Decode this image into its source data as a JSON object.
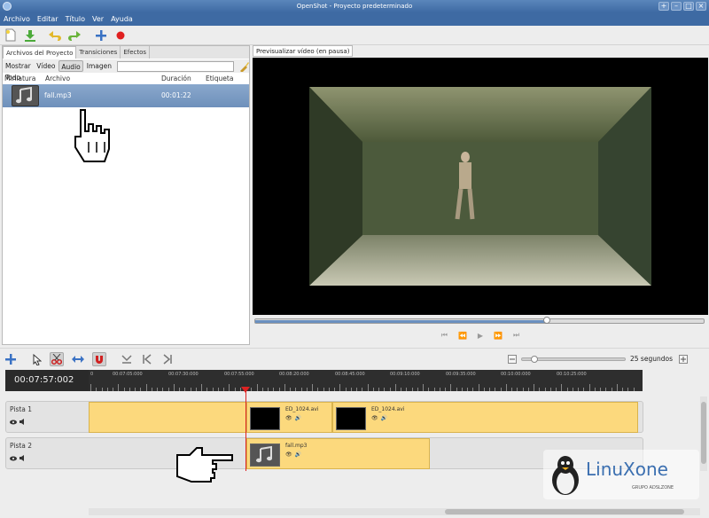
{
  "window": {
    "title": "OpenShot - Proyecto predeterminado"
  },
  "menu": {
    "items": [
      "Archivo",
      "Editar",
      "Título",
      "Ver",
      "Ayuda"
    ]
  },
  "project": {
    "tabs": [
      "Archivos del Proyecto",
      "Transiciones",
      "Efectos"
    ],
    "filters": [
      "Mostrar Todo",
      "Vídeo",
      "Audio",
      "Imagen"
    ],
    "active_filter": "Audio",
    "search_placeholder": "",
    "columns": [
      "Miniatura",
      "Archivo",
      "Duración",
      "Etiqueta"
    ],
    "files": [
      {
        "name": "fall.mp3",
        "duration": "00:01:22",
        "label": ""
      }
    ]
  },
  "preview": {
    "label": "Previsualizar vídeo (en pausa)",
    "position": 0.65
  },
  "timeline": {
    "timecode": "00:07:57:002",
    "zoom_label": "25 segundos",
    "ruler_labels": [
      "0",
      "00:07:05:000",
      "00:07:30:000",
      "00:07:55:000",
      "00:08:20:000",
      "00:08:45:000",
      "00:09:10:000",
      "00:09:35:000",
      "00:10:00:000",
      "00:10:25:000"
    ],
    "tracks": [
      {
        "name": "Pista 1",
        "clips": [
          {
            "name": "ED_1024.avi"
          },
          {
            "name": "ED_1024.avi"
          }
        ]
      },
      {
        "name": "Pista 2",
        "clips": [
          {
            "name": "fall.mp3"
          }
        ]
      }
    ]
  },
  "watermark": {
    "brand": "LinuXone",
    "sub": "GRUPO ADSLZONE"
  }
}
